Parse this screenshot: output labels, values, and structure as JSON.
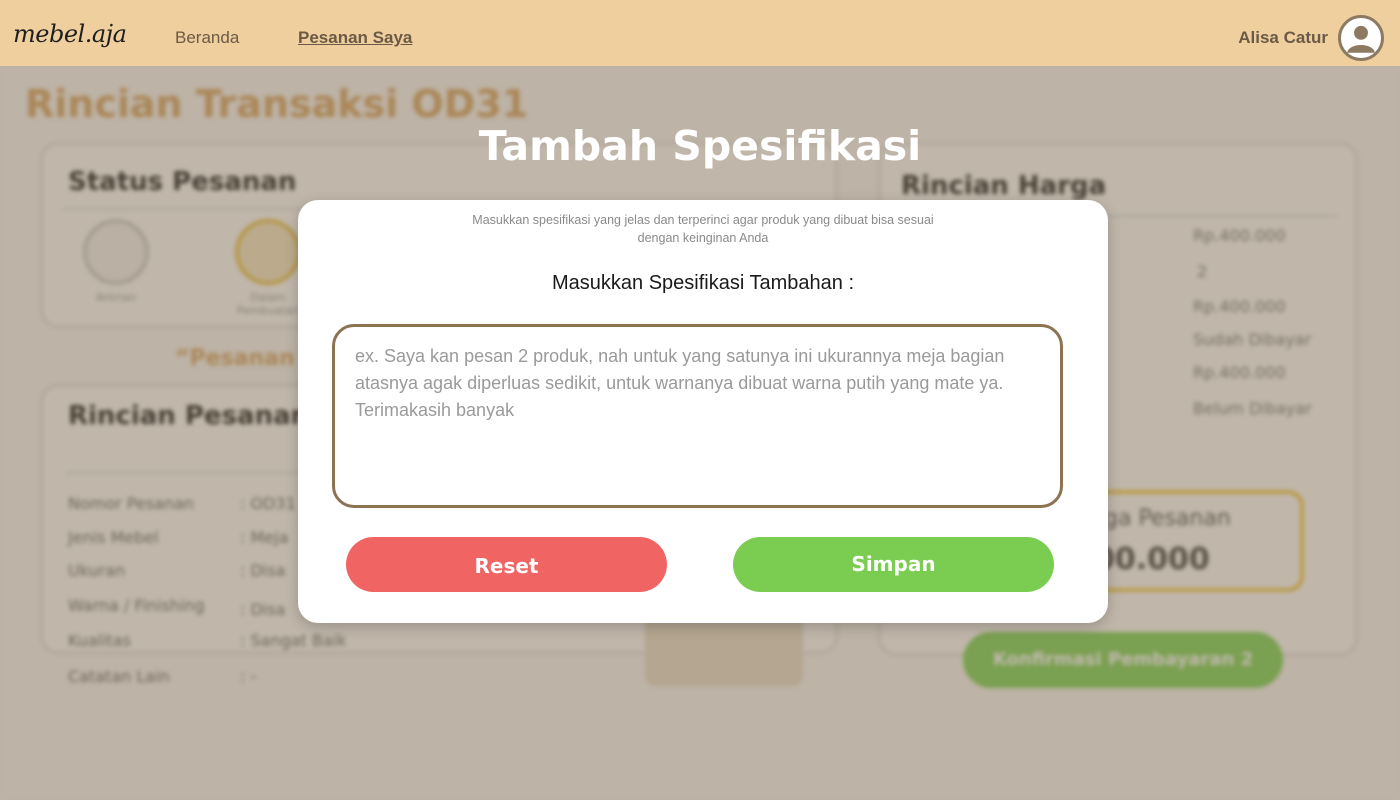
{
  "header": {
    "logo": "mebel.aja",
    "nav": {
      "home": "Beranda",
      "orders": "Pesanan Saya"
    },
    "user_name": "Alisa Catur",
    "avatar_icon": "user-avatar-icon"
  },
  "background": {
    "page_title": "Rincian Transaksi OD31",
    "status_card": {
      "title": "Status Pesanan",
      "steps": [
        {
          "label": "Antrian",
          "icon": "queue-icon",
          "active": false
        },
        {
          "label": "Dalam Pembuatan",
          "icon": "hammer-icon",
          "active": true
        }
      ]
    },
    "note": "“Pesanan",
    "detail_card": {
      "title": "Rincian Pesanan",
      "rows": [
        {
          "label": "Nomor Pesanan",
          "value": ": OD31"
        },
        {
          "label": "Jenis Mebel",
          "value": ": Meja"
        },
        {
          "label": "Ukuran",
          "value": ": Disa"
        },
        {
          "label": "Warna / Finishing",
          "value": ": Disa"
        },
        {
          "label": "Kualitas",
          "value": ": Sangat Baik"
        },
        {
          "label": "Catatan Lain",
          "value": ": -"
        }
      ]
    },
    "price_card": {
      "title": "Rincian Harga",
      "rows": [
        {
          "value": "Rp.400.000"
        },
        {
          "value": "2"
        },
        {
          "value": "Rp.400.000"
        },
        {
          "value": "Sudah Dibayar"
        },
        {
          "value": "Rp.400.000"
        },
        {
          "value": "Belum Dibayar"
        }
      ],
      "total_label": "ga Pesanan",
      "total_value": "00.000"
    },
    "confirm_button": "Konfirmasi Pembayaran 2"
  },
  "modal": {
    "title": "Tambah Spesifikasi",
    "description": "Masukkan spesifikasi yang jelas dan terperinci agar produk yang dibuat bisa sesuai dengan keinginan Anda",
    "field_label": "Masukkan Spesifikasi Tambahan :",
    "placeholder": "ex. Saya kan pesan 2 produk, nah untuk yang satunya ini ukurannya meja bagian atasnya agak diperluas sedikit, untuk warnanya dibuat warna putih yang mate ya. Terimakasih banyak",
    "reset_label": "Reset",
    "save_label": "Simpan"
  },
  "colors": {
    "header_bg": "#efcf9e",
    "accent_gold": "#d4a463",
    "reset": "#f16464",
    "save": "#7bcd52",
    "input_border": "#8c7352"
  }
}
